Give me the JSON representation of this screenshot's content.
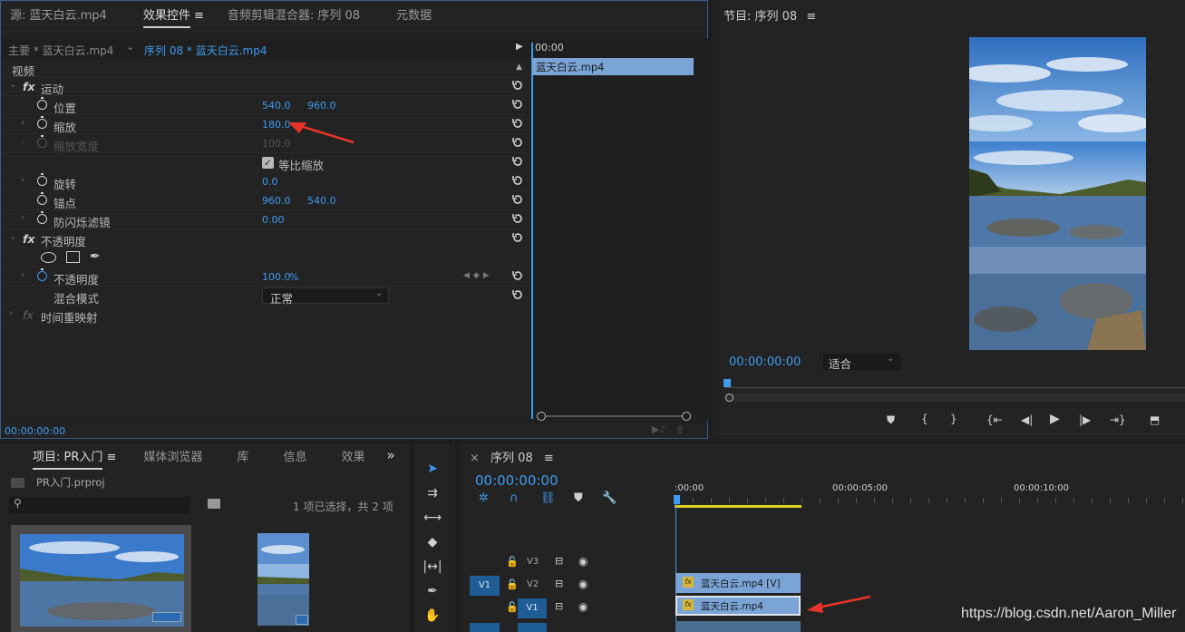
{
  "effect_panel": {
    "tabs": [
      {
        "label": "源: 蓝天白云.mp4"
      },
      {
        "label": "效果控件"
      },
      {
        "label": "音频剪辑混合器: 序列 08"
      },
      {
        "label": "元数据"
      }
    ],
    "menu_glyph": "≡",
    "master_label": "主要 * 蓝天白云.mp4",
    "sequence_label": "序列 08 * 蓝天白云.mp4",
    "timeline_time": "00:00",
    "clip_name": "蓝天白云.mp4",
    "section_video": "视频",
    "fx_symbol": "fx",
    "motion": "运动",
    "position": {
      "label": "位置",
      "x": "540.0",
      "y": "960.0"
    },
    "scale": {
      "label": "缩放",
      "value": "180.0"
    },
    "scale_width": {
      "label": "缩放宽度",
      "value": "100.0"
    },
    "uniform_scale": "等比缩放",
    "rotation": {
      "label": "旋转",
      "value": "0.0"
    },
    "anchor": {
      "label": "锚点",
      "x": "960.0",
      "y": "540.0"
    },
    "antiflicker": {
      "label": "防闪烁滤镜",
      "value": "0.00"
    },
    "opacity_section": "不透明度",
    "opacity": {
      "label": "不透明度",
      "value": "100.0",
      "unit": "%"
    },
    "blend_mode": {
      "label": "混合模式",
      "value": "正常"
    },
    "time_remap": "时间重映射",
    "footer_time": "00:00:00:00"
  },
  "program_monitor": {
    "title": "节目: 序列 08",
    "menu_glyph": "≡",
    "timecode": "00:00:00:00",
    "fit": "适合"
  },
  "project_panel": {
    "tabs": [
      {
        "label": "项目: PR入门"
      },
      {
        "label": "媒体浏览器"
      },
      {
        "label": "库"
      },
      {
        "label": "信息"
      },
      {
        "label": "效果"
      }
    ],
    "menu_glyph": "≡",
    "more_glyph": "»",
    "project_file": "PR入门.prproj",
    "selection_info": "1 项已选择，共 2 项"
  },
  "timeline": {
    "close_glyph": "×",
    "title": "序列 08",
    "menu_glyph": "≡",
    "timecode": "00:00:00:00",
    "ruler": [
      ":00:00",
      "00:00:05:00",
      "00:00:10:00"
    ],
    "tracks": [
      {
        "name": "V3",
        "source": ""
      },
      {
        "name": "V2",
        "source": "V1"
      },
      {
        "name": "V1",
        "source": ""
      }
    ],
    "clip_v2": "蓝天白云.mp4 [V]",
    "clip_v1": "蓝天白云.mp4",
    "fx_badge": "fx"
  },
  "watermark": "https://blog.csdn.net/Aaron_Miller",
  "colors": {
    "accent_blue": "#3e9bf0",
    "clip_blue": "#7aa4d6",
    "arrow_red": "#e8342a",
    "work_area_yellow": "#d8d21f"
  }
}
